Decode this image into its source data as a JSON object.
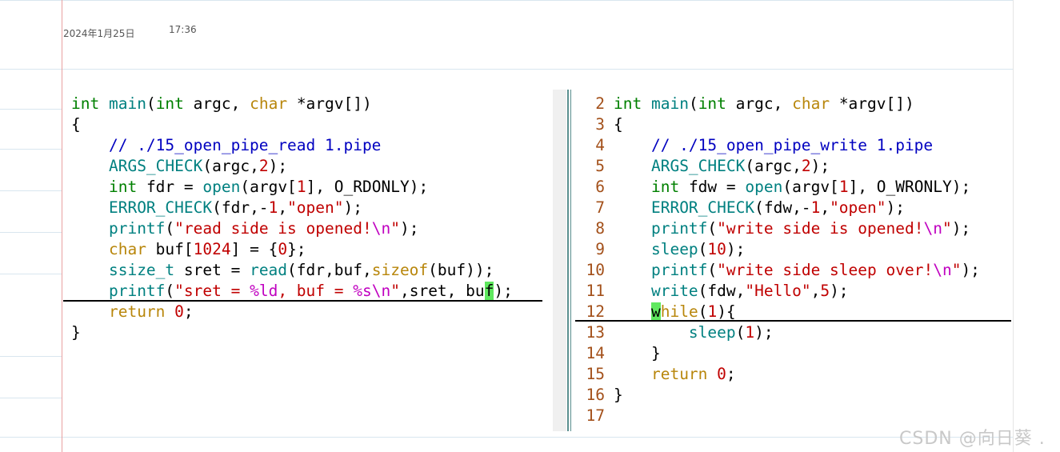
{
  "note": {
    "date": "2024年1月25日",
    "time": "17:36"
  },
  "left_code": [
    [
      [
        "int ",
        "#008000"
      ],
      [
        "main",
        "#008080"
      ],
      [
        "(",
        "#000"
      ],
      [
        "int ",
        "#008000"
      ],
      [
        "argc, ",
        "#000"
      ],
      [
        "char ",
        "#b8860b"
      ],
      [
        "*argv[])",
        "#000"
      ]
    ],
    [
      [
        "{",
        "#000"
      ]
    ],
    [
      [
        "    // ./15_open_pipe_read 1.pipe",
        "#0000c0"
      ]
    ],
    [
      [
        "    ",
        "#000"
      ],
      [
        "ARGS_CHECK",
        "#008080"
      ],
      [
        "(argc,",
        "#000"
      ],
      [
        "2",
        "#c00000"
      ],
      [
        ");",
        "#000"
      ]
    ],
    [
      [
        "    ",
        "#000"
      ],
      [
        "int ",
        "#008000"
      ],
      [
        "fdr = ",
        "#000"
      ],
      [
        "open",
        "#008080"
      ],
      [
        "(argv[",
        "#000"
      ],
      [
        "1",
        "#c00000"
      ],
      [
        "], O_RDONLY);",
        "#000"
      ]
    ],
    [
      [
        "    ",
        "#000"
      ],
      [
        "ERROR_CHECK",
        "#008080"
      ],
      [
        "(fdr,-",
        "#000"
      ],
      [
        "1",
        "#c00000"
      ],
      [
        ",",
        "#000"
      ],
      [
        "\"open\"",
        "#c00000"
      ],
      [
        ");",
        "#000"
      ]
    ],
    [
      [
        "    ",
        "#000"
      ],
      [
        "printf",
        "#008080"
      ],
      [
        "(",
        "#000"
      ],
      [
        "\"read side is opened!",
        "#c00000"
      ],
      [
        "\\n",
        "#c000c0"
      ],
      [
        "\"",
        "#c00000"
      ],
      [
        ");",
        "#000"
      ]
    ],
    [
      [
        "    ",
        "#000"
      ],
      [
        "char ",
        "#b8860b"
      ],
      [
        "buf[",
        "#000"
      ],
      [
        "1024",
        "#c00000"
      ],
      [
        "] = {",
        "#000"
      ],
      [
        "0",
        "#c00000"
      ],
      [
        "};",
        "#000"
      ]
    ],
    [
      [
        "    ",
        "#000"
      ],
      [
        "ssize_t ",
        "#008080"
      ],
      [
        "sret = ",
        "#000"
      ],
      [
        "read",
        "#008080"
      ],
      [
        "(fdr,buf,",
        "#000"
      ],
      [
        "sizeof",
        "#b8860b"
      ],
      [
        "(buf));",
        "#000"
      ]
    ],
    [
      [
        "    ",
        "#000"
      ],
      [
        "printf",
        "#008080"
      ],
      [
        "(",
        "#000"
      ],
      [
        "\"sret = ",
        "#c00000"
      ],
      [
        "%ld",
        "#c000c0"
      ],
      [
        ", buf = ",
        "#c00000"
      ],
      [
        "%s",
        "#c000c0"
      ],
      [
        "\\n",
        "#c000c0"
      ],
      [
        "\"",
        "#c00000"
      ],
      [
        ",sret, bu",
        "#000"
      ],
      [
        "f",
        "HL"
      ],
      [
        ");",
        "#000"
      ]
    ],
    [
      [
        "    ",
        "#000"
      ],
      [
        "return ",
        "#b8860b"
      ],
      [
        "0",
        "#c00000"
      ],
      [
        ";",
        "#000"
      ]
    ],
    [
      [
        "}",
        "#000"
      ]
    ]
  ],
  "right_line_numbers": [
    "2",
    "3",
    "4",
    "5",
    "6",
    "7",
    "8",
    "9",
    "10",
    "11",
    "12",
    "13",
    "14",
    "15",
    "16",
    "17"
  ],
  "right_code": [
    [
      [
        "int ",
        "#008000"
      ],
      [
        "main",
        "#008080"
      ],
      [
        "(",
        "#000"
      ],
      [
        "int ",
        "#008000"
      ],
      [
        "argc, ",
        "#000"
      ],
      [
        "char ",
        "#b8860b"
      ],
      [
        "*argv[])",
        "#000"
      ]
    ],
    [
      [
        "{",
        "#000"
      ]
    ],
    [
      [
        "    // ./15_open_pipe_write 1.pipe",
        "#0000c0"
      ]
    ],
    [
      [
        "    ",
        "#000"
      ],
      [
        "ARGS_CHECK",
        "#008080"
      ],
      [
        "(argc,",
        "#000"
      ],
      [
        "2",
        "#c00000"
      ],
      [
        ");",
        "#000"
      ]
    ],
    [
      [
        "    ",
        "#000"
      ],
      [
        "int ",
        "#008000"
      ],
      [
        "fdw = ",
        "#000"
      ],
      [
        "open",
        "#008080"
      ],
      [
        "(argv[",
        "#000"
      ],
      [
        "1",
        "#c00000"
      ],
      [
        "], O_WRONLY);",
        "#000"
      ]
    ],
    [
      [
        "    ",
        "#000"
      ],
      [
        "ERROR_CHECK",
        "#008080"
      ],
      [
        "(fdw,-",
        "#000"
      ],
      [
        "1",
        "#c00000"
      ],
      [
        ",",
        "#000"
      ],
      [
        "\"open\"",
        "#c00000"
      ],
      [
        ");",
        "#000"
      ]
    ],
    [
      [
        "    ",
        "#000"
      ],
      [
        "printf",
        "#008080"
      ],
      [
        "(",
        "#000"
      ],
      [
        "\"write side is opened!",
        "#c00000"
      ],
      [
        "\\n",
        "#c000c0"
      ],
      [
        "\"",
        "#c00000"
      ],
      [
        ");",
        "#000"
      ]
    ],
    [
      [
        "    ",
        "#000"
      ],
      [
        "sleep",
        "#008080"
      ],
      [
        "(",
        "#000"
      ],
      [
        "10",
        "#c00000"
      ],
      [
        ");",
        "#000"
      ]
    ],
    [
      [
        "    ",
        "#000"
      ],
      [
        "printf",
        "#008080"
      ],
      [
        "(",
        "#000"
      ],
      [
        "\"write side sleep over!",
        "#c00000"
      ],
      [
        "\\n",
        "#c000c0"
      ],
      [
        "\"",
        "#c00000"
      ],
      [
        ");",
        "#000"
      ]
    ],
    [
      [
        "    ",
        "#000"
      ],
      [
        "write",
        "#008080"
      ],
      [
        "(fdw,",
        "#000"
      ],
      [
        "\"Hello\"",
        "#c00000"
      ],
      [
        ",",
        "#000"
      ],
      [
        "5",
        "#c00000"
      ],
      [
        ");",
        "#000"
      ]
    ],
    [
      [
        "    ",
        "#000"
      ],
      [
        "w",
        "HL"
      ],
      [
        "hile",
        "#b8860b"
      ],
      [
        "(",
        "#000"
      ],
      [
        "1",
        "#c00000"
      ],
      [
        "){",
        "#000"
      ]
    ],
    [
      [
        "        ",
        "#000"
      ],
      [
        "sleep",
        "#008080"
      ],
      [
        "(",
        "#000"
      ],
      [
        "1",
        "#c00000"
      ],
      [
        ");",
        "#000"
      ]
    ],
    [
      [
        "    }",
        "#000"
      ]
    ],
    [
      [
        "    ",
        "#000"
      ],
      [
        "return ",
        "#b8860b"
      ],
      [
        "0",
        "#c00000"
      ],
      [
        ";",
        "#000"
      ]
    ],
    [
      [
        "}",
        "#000"
      ]
    ],
    [
      [
        "",
        "#000"
      ]
    ]
  ],
  "watermark": "CSDN @向日葵 ."
}
